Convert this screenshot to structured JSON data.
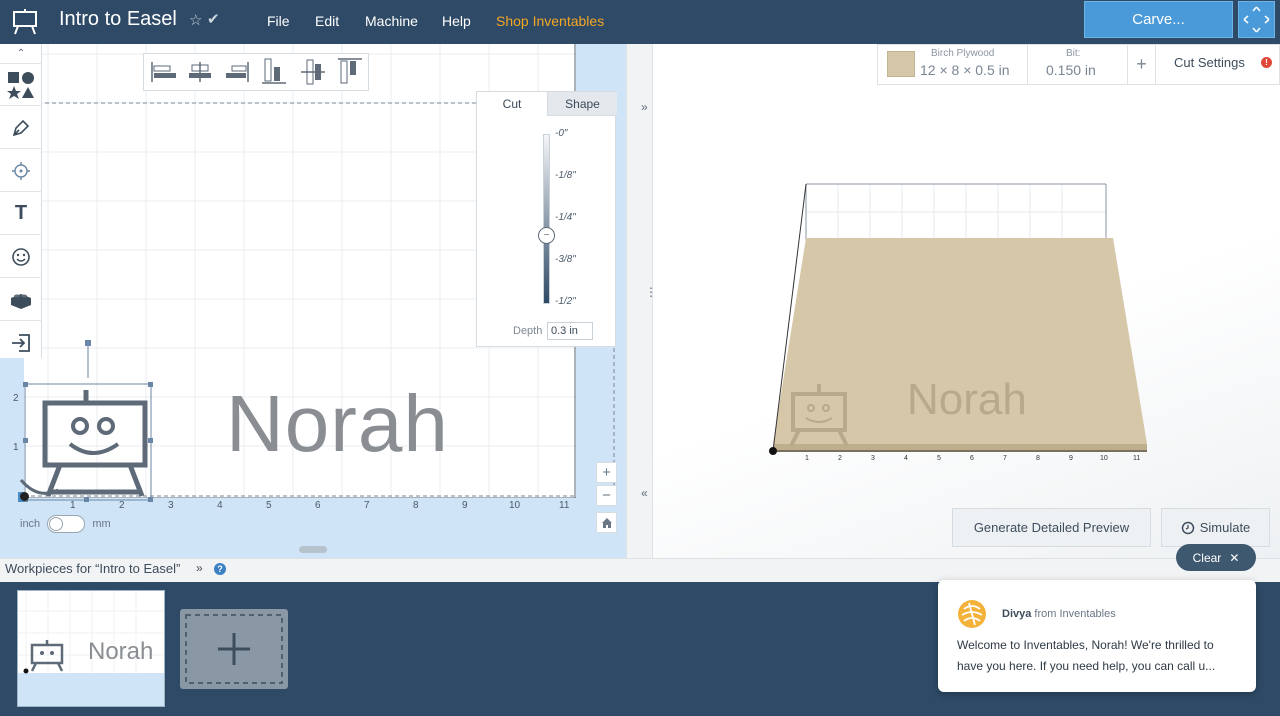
{
  "header": {
    "title": "Intro to Easel",
    "star": "☆",
    "check": "✔",
    "menu": [
      "File",
      "Edit",
      "Machine",
      "Help",
      "Shop Inventables"
    ],
    "carve_label": "Carve..."
  },
  "design": {
    "cut_tab": "Cut",
    "shape_tab": "Shape",
    "depth_ticks": [
      "-0\"",
      "-1/8\"",
      "-1/4\"",
      "-3/8\"",
      "-1/2\""
    ],
    "depth_label": "Depth",
    "depth_value": "0.3 in",
    "x_ticks": [
      "1",
      "2",
      "3",
      "4",
      "5",
      "6",
      "7",
      "8",
      "9",
      "10",
      "11"
    ],
    "y_ticks": [
      "1",
      "2"
    ],
    "text_object": "Norah",
    "unit_left": "inch",
    "unit_right": "mm"
  },
  "preview": {
    "material_name": "Birch Plywood",
    "material_size": "12 × 8 × 0.5 in",
    "bit_label": "Bit:",
    "bit_value": "0.150 in",
    "add_label": "+",
    "cut_settings": "Cut Settings",
    "text_object": "Norah",
    "generate_label": "Generate Detailed Preview",
    "simulate_label": "Simulate",
    "x_ticks": [
      "1",
      "2",
      "3",
      "4",
      "5",
      "6",
      "7",
      "8",
      "9",
      "10",
      "11"
    ]
  },
  "workpieces": {
    "label": "Workpieces for “Intro to Easel”",
    "thumb_text": "Norah"
  },
  "clear_label": "Clear",
  "chat": {
    "sender": "Divya",
    "from_text": "from Inventables",
    "message": "Welcome to Inventables, Norah! We're thrilled to have you here. If you need help, you can call u..."
  }
}
